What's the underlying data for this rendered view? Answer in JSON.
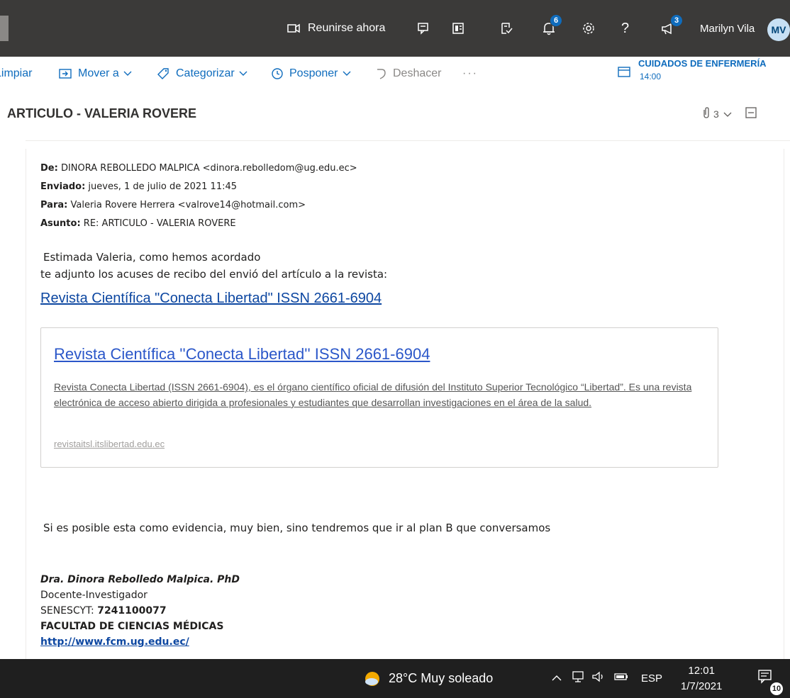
{
  "topbar": {
    "meet_label": "Reunirse ahora",
    "notifications_badge": "6",
    "feedback_badge": "3",
    "user_name": "Marilyn Vila",
    "avatar_initials": "MV",
    "help_glyph": "?"
  },
  "commands": {
    "clear": "Limpiar",
    "move": "Mover a",
    "categorize": "Categorizar",
    "snooze": "Posponer",
    "undo": "Deshacer",
    "more": "···"
  },
  "reminder": {
    "title": "CUIDADOS DE ENFERMERÍA",
    "time": "14:00"
  },
  "email": {
    "subject": "ARTICULO - VALERIA ROVERE",
    "attachment_count": "3",
    "from_label": "De:",
    "from_value": "DINORA REBOLLEDO MALPICA <dinora.rebolledom@ug.edu.ec>",
    "sent_label": "Enviado:",
    "sent_value": "jueves, 1 de julio de 2021 11:45",
    "to_label": "Para:",
    "to_value": "Valeria Rovere Herrera <valrove14@hotmail.com>",
    "subj_label": "Asunto:",
    "subj_value": "RE: ARTICULO - VALERIA ROVERE",
    "greeting_1": "Estimada Valeria, como hemos acordado",
    "greeting_2": "te adjunto los acuses de recibo del envió del artículo a la revista:",
    "link_text": "Revista Científica \"Conecta Libertad\" ISSN 2661-6904",
    "card_title": "Revista Científica ''Conecta Libertad'' ISSN 2661-6904",
    "card_desc": "Revista Conecta Libertad (ISSN 2661-6904), es el órgano científico oficial de difusión del Instituto Superior Tecnológico “Libertad”. Es una revista electrónica de acceso abierto dirigida a profesionales y estudiantes que desarrollan investigaciones en el área de la salud.",
    "card_domain": "revistaitsl.itslibertad.edu.ec",
    "closing": "Si es posible esta como evidencia, muy bien, sino tendremos que ir al plan B que conversamos",
    "sig_name": "Dra. Dinora Rebolledo Malpica. PhD",
    "sig_role": "Docente-Investigador",
    "sig_senescyt_label": "SENESCYT:",
    "sig_senescyt_value": "7241100077",
    "sig_faculty": "FACULTAD DE CIENCIAS MÉDICAS",
    "sig_url": "http://www.fcm.ug.edu.ec/"
  },
  "taskbar": {
    "weather": "28°C  Muy soleado",
    "language": "ESP",
    "time": "12:01",
    "date": "1/7/2021",
    "notif_count": "10"
  },
  "colors": {
    "accent": "#0f6cbd",
    "topbar": "#3b3a39",
    "taskbar": "#1f1f1f"
  }
}
